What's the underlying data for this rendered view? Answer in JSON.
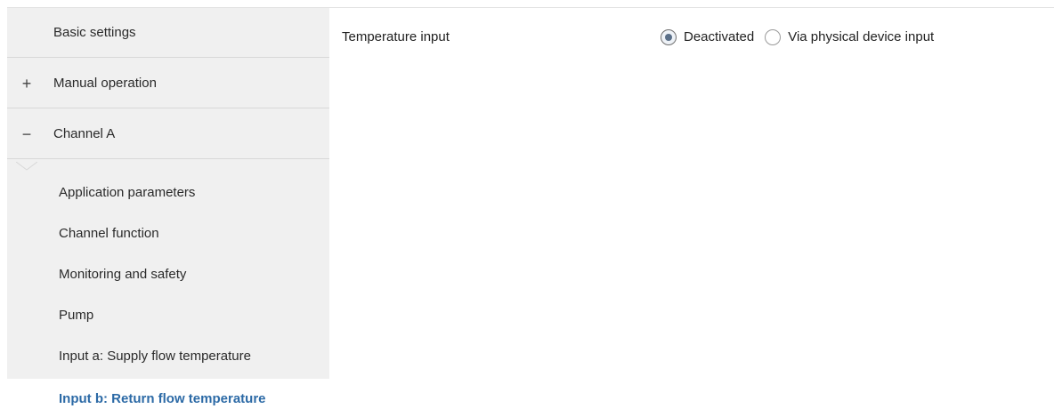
{
  "sidebar": {
    "top_items": [
      {
        "label": "Basic settings",
        "expander": ""
      },
      {
        "label": "Manual operation",
        "expander": "+"
      },
      {
        "label": "Channel A",
        "expander": "−"
      }
    ],
    "sub_items": [
      {
        "label": "Application parameters"
      },
      {
        "label": "Channel function"
      },
      {
        "label": "Monitoring and safety"
      },
      {
        "label": "Pump"
      },
      {
        "label": "Input a: Supply flow temperature"
      },
      {
        "label": "Input b: Return flow temperature",
        "active": true
      }
    ]
  },
  "main": {
    "parameter": {
      "label": "Temperature input",
      "options": [
        {
          "label": "Deactivated",
          "selected": true
        },
        {
          "label": "Via physical device input",
          "selected": false
        }
      ]
    }
  },
  "colors": {
    "sidebar_bg": "#f0f0f0",
    "active_text": "#2c6aa6",
    "radio_dot": "#5a6f88"
  }
}
